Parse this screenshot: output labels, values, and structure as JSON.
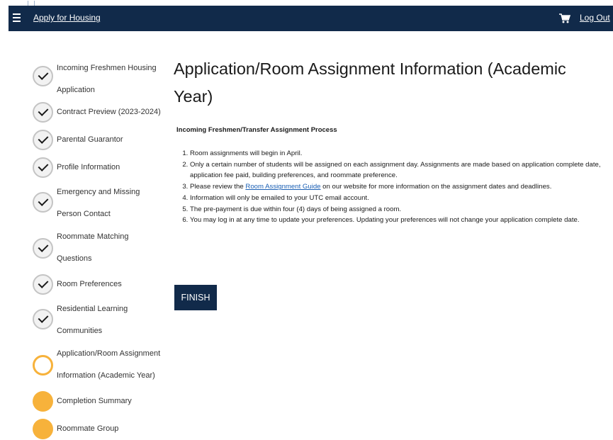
{
  "topbar": {
    "apply_label": "Apply for Housing",
    "logout_label": "Log Out"
  },
  "steps": [
    {
      "label1": "Incoming Freshmen Housing",
      "label2": "Application",
      "status": "complete"
    },
    {
      "label1": "Contract Preview (2023-2024)",
      "status": "complete"
    },
    {
      "label1": "Parental Guarantor",
      "status": "complete"
    },
    {
      "label1": "Profile Information",
      "status": "complete"
    },
    {
      "label1": "Emergency and Missing",
      "label2": "Person Contact",
      "status": "complete"
    },
    {
      "label1": "Roommate Matching",
      "label2": "Questions",
      "status": "complete"
    },
    {
      "label1": "Room Preferences",
      "status": "complete"
    },
    {
      "label1": "Residential Learning",
      "label2": "Communities",
      "status": "complete"
    },
    {
      "label1": "Application/Room Assignment",
      "label2": "Information (Academic Year)",
      "status": "current"
    },
    {
      "label1": "Completion Summary",
      "status": "upcoming"
    },
    {
      "label1": "Roommate Group",
      "status": "upcoming"
    }
  ],
  "main": {
    "title": "Application/Room Assignment Information (Academic Year)",
    "subhead": "Incoming Freshmen/Transfer Assignment Process",
    "items": {
      "i1": "Room assignments will begin in April.",
      "i2": "Only a certain number of students will be assigned on each assignment day. Assignments are made based on application complete date, application fee paid, building preferences, and roommate preference.",
      "i3_before": "Please review the ",
      "i3_link": "Room Assignment Guide",
      "i3_after": " on our website for more information on the assignment dates and deadlines.",
      "i4": "Information will only be emailed to your UTC email account.",
      "i5": "The pre-payment is due within four (4) days of being assigned a room.",
      "i6": "You may log in at any time to update your preferences. Updating your preferences will not change your application complete date."
    },
    "finish_label": "FINISH"
  },
  "colors": {
    "navy": "#112a4a",
    "accent_orange": "#f7b23b",
    "link_blue": "#1a5fb4"
  },
  "icons": {
    "menu": "hamburger-icon",
    "cart": "shopping-cart-icon",
    "complete": "checkmark-icon"
  }
}
